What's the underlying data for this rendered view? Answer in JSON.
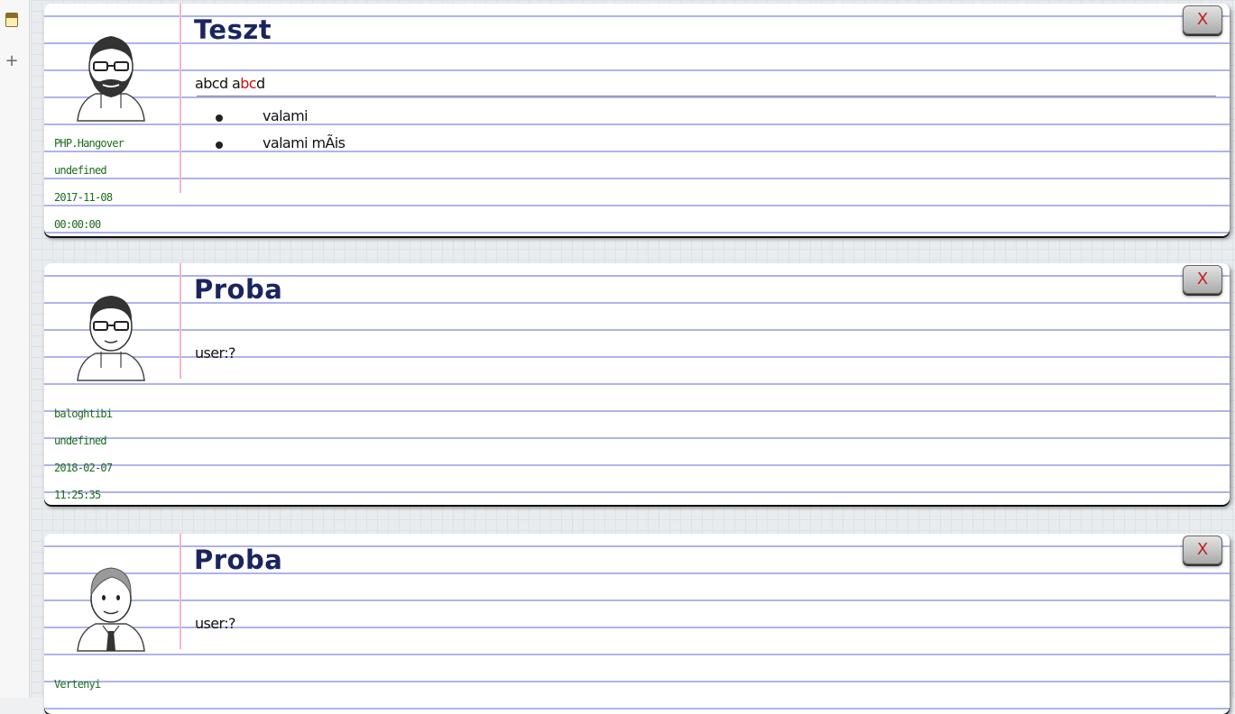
{
  "sidebar": {
    "note_icon": "note-icon",
    "add_icon": "plus-icon",
    "add_label": "+"
  },
  "notes": [
    {
      "title": "Teszt",
      "body_prefix": "abcd a",
      "body_red": "bc",
      "body_suffix": "d",
      "bullets": [
        "valami",
        "valami mÃis"
      ],
      "author": "PHP.Hangover",
      "field": "undefined",
      "date": "2017-11-08",
      "time": "00:00:00",
      "close_label": "X",
      "avatar": "bearded-man-avatar"
    },
    {
      "title": "Proba",
      "body": "user:?",
      "author": "baloghtibi",
      "field": "undefined",
      "date": "2018-02-07",
      "time": "11:25:35",
      "close_label": "X",
      "avatar": "glasses-man-avatar"
    },
    {
      "title": "Proba",
      "body": "user:?",
      "author": "Vertenyi",
      "close_label": "X",
      "avatar": "businessman-avatar"
    }
  ],
  "colors": {
    "title": "#1a2560",
    "meta": "#1a6b1a",
    "highlight": "#d01010",
    "rule": "#aeb3ee",
    "margin": "#f4b6c8"
  }
}
